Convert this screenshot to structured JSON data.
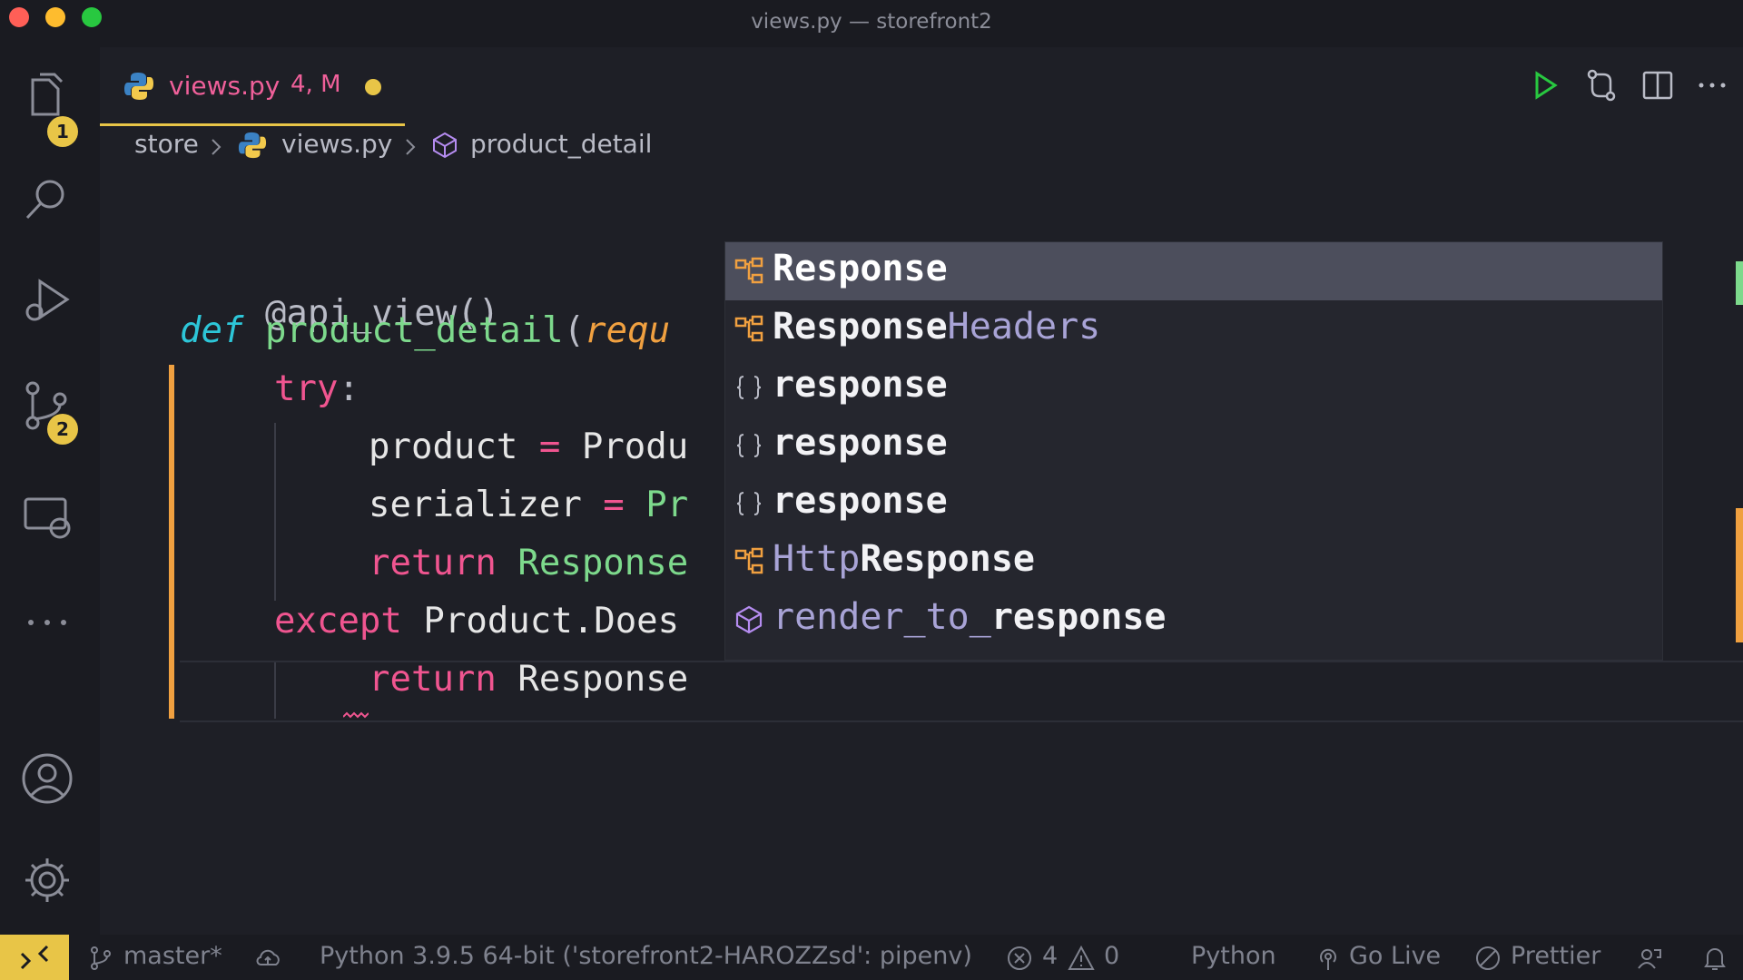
{
  "window": {
    "title": "views.py — storefront2"
  },
  "activity_bar": {
    "explorer_badge": "1",
    "scm_badge": "2"
  },
  "tab": {
    "file_name": "views.py",
    "status": "4, M"
  },
  "breadcrumb": {
    "folder": "store",
    "file": "views.py",
    "symbol": "product_detail"
  },
  "code": {
    "line1": "@api_view()",
    "line2_def": "def",
    "line2_fn": "product_detail",
    "line2_paren": "(",
    "line2_param": "requ",
    "line3_try": "try",
    "line3_colon": ":",
    "line4_var": "product",
    "line4_eq": "=",
    "line4_rest": "Produ",
    "line5_var": "serializer",
    "line5_eq": "=",
    "line5_rest": "Pr",
    "line6_return": "return",
    "line6_rest": "Response",
    "line7_except": "except",
    "line7_rest": "Product.Does",
    "line8_return": "return",
    "line8_rest": "Response"
  },
  "suggestions": [
    {
      "match": "Response",
      "rest_before": "",
      "rest_after": "",
      "kind": "class-icon"
    },
    {
      "match": "Response",
      "rest_before": "",
      "rest_after": "Headers",
      "kind": "class-icon"
    },
    {
      "match": "response",
      "rest_before": "",
      "rest_after": "",
      "kind": "variable-icon"
    },
    {
      "match": "response",
      "rest_before": "",
      "rest_after": "",
      "kind": "variable-icon"
    },
    {
      "match": "response",
      "rest_before": "",
      "rest_after": "",
      "kind": "variable-icon"
    },
    {
      "match": "Response",
      "rest_before": "Http",
      "rest_after": "",
      "kind": "class-icon"
    },
    {
      "match": "response",
      "rest_before": "render_to_",
      "rest_after": "",
      "kind": "method-icon"
    }
  ],
  "status_bar": {
    "branch": "master*",
    "interpreter": "Python 3.9.5 64-bit ('storefront2-HAROZZsd': pipenv)",
    "errors": "4",
    "warnings": "0",
    "language": "Python",
    "go_live": "Go Live",
    "prettier": "Prettier"
  },
  "colors": {
    "accent": "#e8c547",
    "keyword": "#f05590",
    "function": "#7dd98c",
    "parameter": "#f0a040",
    "def_keyword": "#2dc6d8"
  }
}
